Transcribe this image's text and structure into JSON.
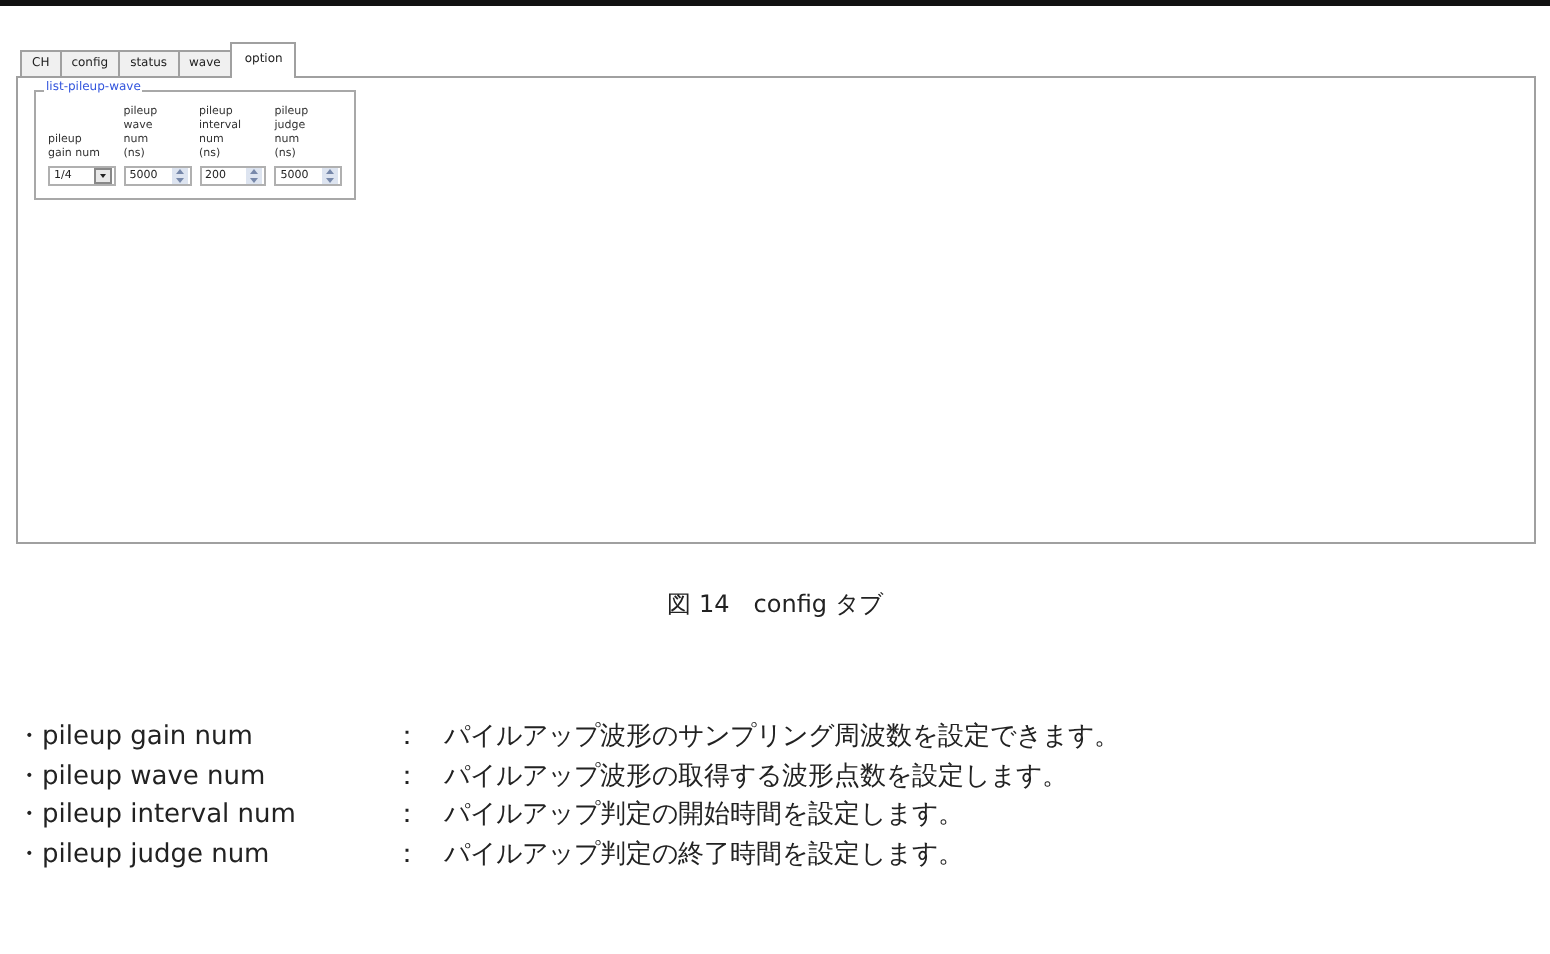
{
  "window": {
    "tabs": [
      {
        "label": "CH",
        "selected": false
      },
      {
        "label": "config",
        "selected": false
      },
      {
        "label": "status",
        "selected": false
      },
      {
        "label": "wave",
        "selected": false
      },
      {
        "label": "option",
        "selected": true
      }
    ],
    "group": {
      "title": "list-pileup-wave",
      "fields": [
        {
          "label": "pileup\ngain num",
          "kind": "dropdown",
          "value": "1/4"
        },
        {
          "label": "pileup\nwave\nnum\n(ns)",
          "kind": "spin",
          "value": "5000"
        },
        {
          "label": "pileup\ninterval\nnum\n(ns)",
          "kind": "spin",
          "value": "200"
        },
        {
          "label": "pileup\njudge\nnum\n(ns)",
          "kind": "spin",
          "value": "5000"
        }
      ]
    }
  },
  "caption": "図 14　config タブ",
  "items": [
    {
      "term": "・pileup gain num",
      "sep": "：",
      "text": "パイルアップ波形のサンプリング周波数を設定できます。"
    },
    {
      "term": "・pileup wave num",
      "sep": "：",
      "text": "パイルアップ波形の取得する波形点数を設定します。"
    },
    {
      "term": "・pileup interval num",
      "sep": "：",
      "text": "パイルアップ判定の開始時間を設定します。"
    },
    {
      "term": "・pileup judge num",
      "sep": "：",
      "text": "パイルアップ判定の終了時間を設定します。"
    }
  ]
}
